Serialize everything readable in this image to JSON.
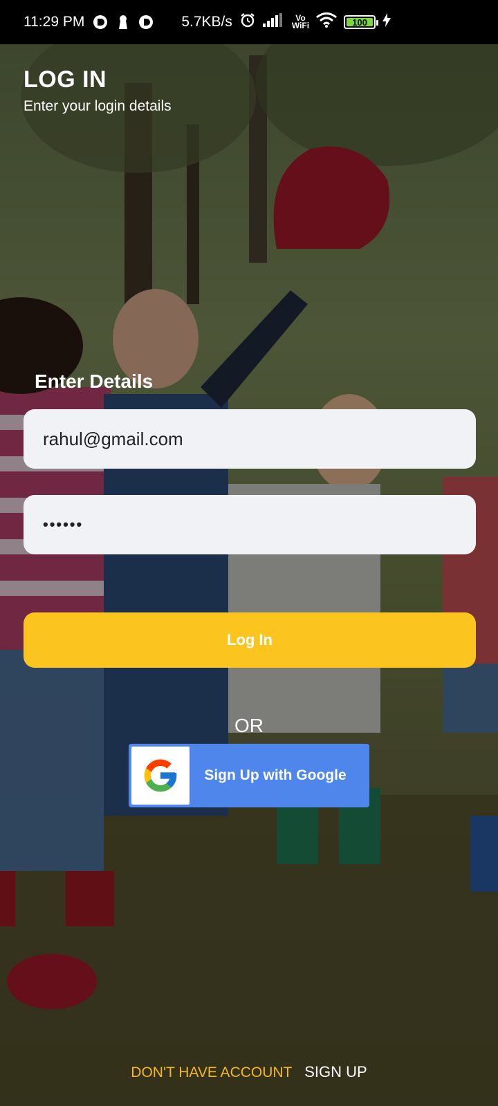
{
  "status_bar": {
    "time": "11:29 PM",
    "network_speed": "5.7KB/s",
    "vowifi_top": "Vo",
    "vowifi_bottom": "WiFi",
    "battery": "100",
    "icons": [
      "notification-icon",
      "keyhole-icon",
      "notification-icon",
      "alarm-icon",
      "signal-icon",
      "vowifi-icon",
      "wifi-icon",
      "battery-icon",
      "charging-icon"
    ]
  },
  "header": {
    "title": "LOG IN",
    "subtitle": "Enter your login details"
  },
  "form": {
    "section_label": "Enter Details",
    "email_value": "rahul@gmail.com",
    "password_value": "••••••",
    "login_label": "Log In"
  },
  "divider_text": "OR",
  "google": {
    "label": "Sign Up with Google",
    "icon": "google-logo-icon"
  },
  "footer": {
    "question": "DON'T HAVE ACCOUNT",
    "signup_label": "SIGN UP"
  },
  "colors": {
    "accent": "#fbc41e",
    "google_blue": "#4f86ec",
    "footer_question": "#f5b824",
    "field_bg": "#f1f2f6"
  }
}
